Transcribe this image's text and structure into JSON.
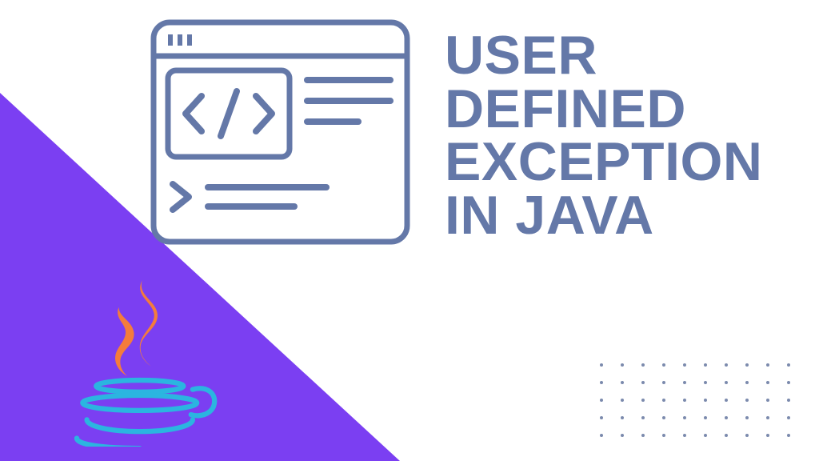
{
  "title": {
    "line1": "USER",
    "line2": "DEFINED",
    "line3": "EXCEPTION",
    "line4": "IN JAVA"
  },
  "colors": {
    "triangle": "#7b3ff2",
    "title_text": "#6478a8",
    "code_window_stroke": "#6478a8",
    "dot": "#7b8aad",
    "java_steam": "#f47c3c",
    "java_cup": "#2bb5e0"
  },
  "decor": {
    "dot_grid_rows": 5,
    "dot_grid_cols": 10
  }
}
